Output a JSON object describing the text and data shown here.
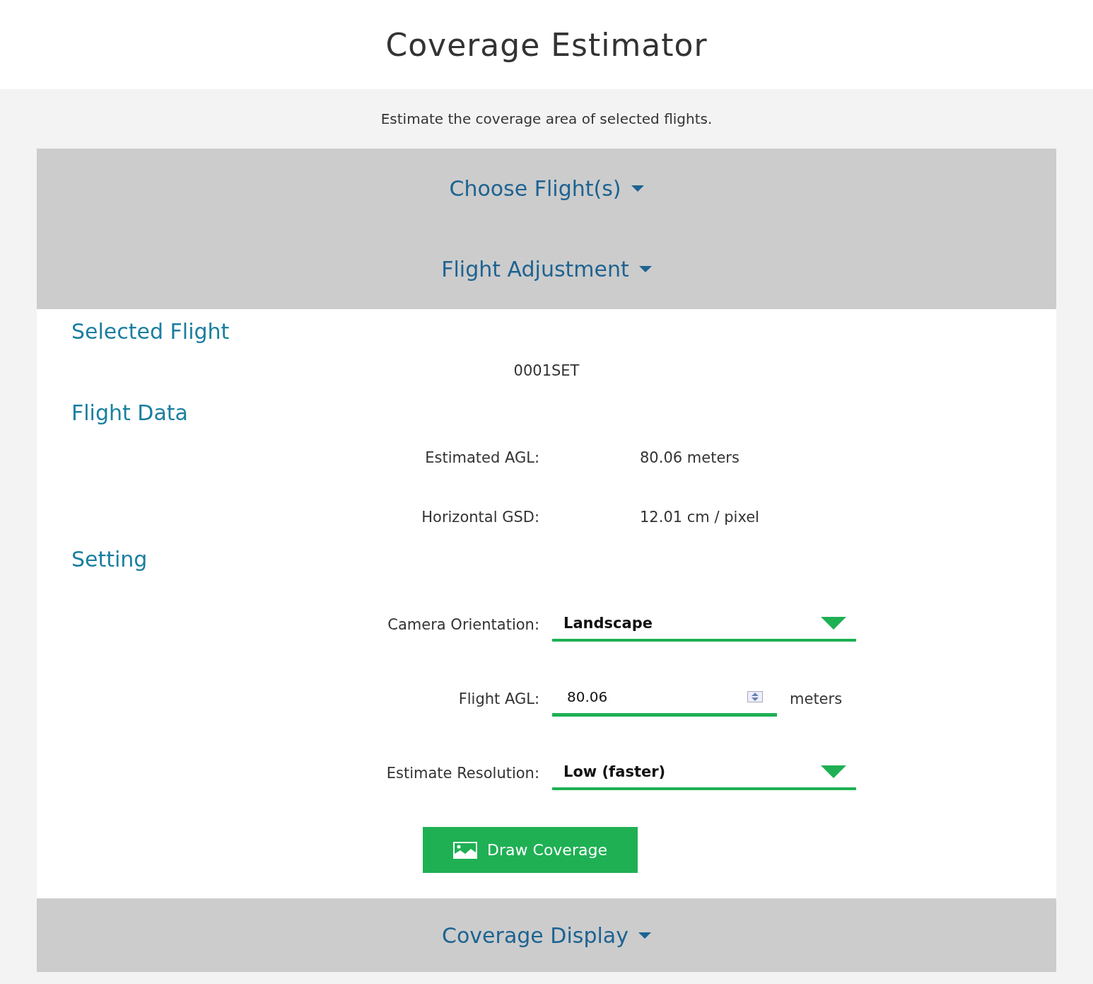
{
  "page": {
    "title": "Coverage Estimator",
    "subtitle": "Estimate the coverage area of selected flights."
  },
  "sections": [
    {
      "title": "Choose Flight(s)"
    },
    {
      "title": "Flight Adjustment",
      "groups": [
        {
          "kind": "text",
          "heading": "Selected Flight",
          "value": "0001SET"
        },
        {
          "kind": "pairs",
          "heading": "Flight Data",
          "rows": [
            {
              "label": "Estimated AGL:",
              "value": "80.06 meters"
            },
            {
              "label": "Horizontal GSD:",
              "value": "12.01 cm / pixel"
            }
          ]
        },
        {
          "kind": "form",
          "heading": "Setting",
          "fields": [
            {
              "kind": "select",
              "label": "Camera Orientation:",
              "value": "Landscape"
            },
            {
              "kind": "number",
              "label": "Flight AGL:",
              "value": "80.06",
              "unit": "meters"
            },
            {
              "kind": "select",
              "label": "Estimate Resolution:",
              "value": "Low (faster)"
            }
          ],
          "button": "Draw Coverage"
        }
      ]
    },
    {
      "title": "Coverage Display"
    }
  ]
}
